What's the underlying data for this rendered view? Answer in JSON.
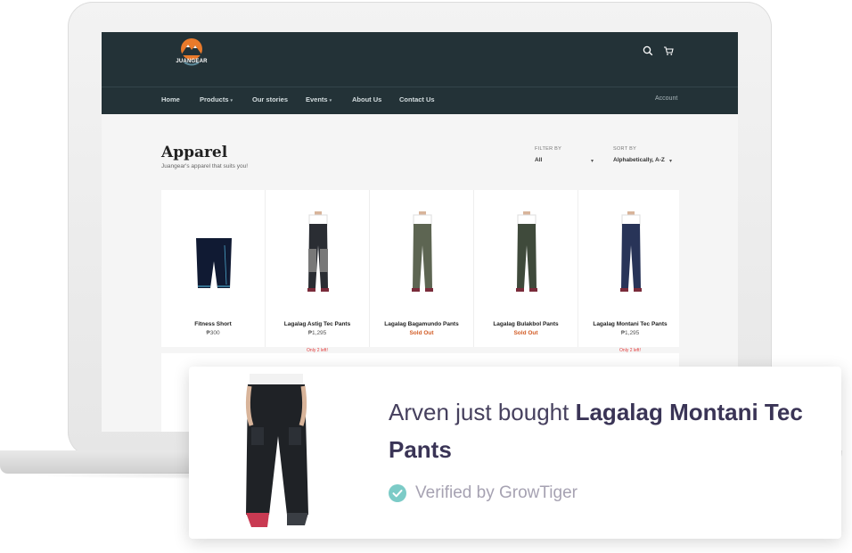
{
  "store": {
    "logo_text": "JUANGEAR",
    "nav": [
      {
        "label": "Home",
        "caret": false
      },
      {
        "label": "Products",
        "caret": true
      },
      {
        "label": "Our stories",
        "caret": false
      },
      {
        "label": "Events",
        "caret": true
      },
      {
        "label": "About Us",
        "caret": false
      },
      {
        "label": "Contact Us",
        "caret": false
      }
    ],
    "account_label": "Account",
    "page_title": "Apparel",
    "page_subtitle": "Juangear's apparel that suits you!",
    "filter": {
      "label": "FILTER BY",
      "value": "All"
    },
    "sort": {
      "label": "SORT BY",
      "value": "Alphabetically, A-Z"
    },
    "products": [
      {
        "name": "Fitness Short",
        "price": "₱300",
        "status": "price",
        "note": ""
      },
      {
        "name": "Lagalag Astig Tec Pants",
        "price": "₱1,295",
        "status": "price",
        "note": "Only 2 left!"
      },
      {
        "name": "Lagalag Bagamundo Pants",
        "price": "Sold Out",
        "status": "sold",
        "note": ""
      },
      {
        "name": "Lagalag Bulakbol Pants",
        "price": "Sold Out",
        "status": "sold",
        "note": ""
      },
      {
        "name": "Lagalag Montani Tec Pants",
        "price": "₱1,295",
        "status": "price",
        "note": "Only 2 left!"
      }
    ]
  },
  "notification": {
    "prefix": "Arven just bought",
    "product": "Lagalag Montani Tec Pants",
    "verified": "Verified by GrowTiger"
  },
  "colors": {
    "header_bg": "#233237",
    "sold_out": "#d25b24",
    "verified_check": "#7ccbc7",
    "notification_text": "#46405e"
  },
  "icons": [
    "search-icon",
    "cart-icon",
    "verified-check-icon"
  ]
}
